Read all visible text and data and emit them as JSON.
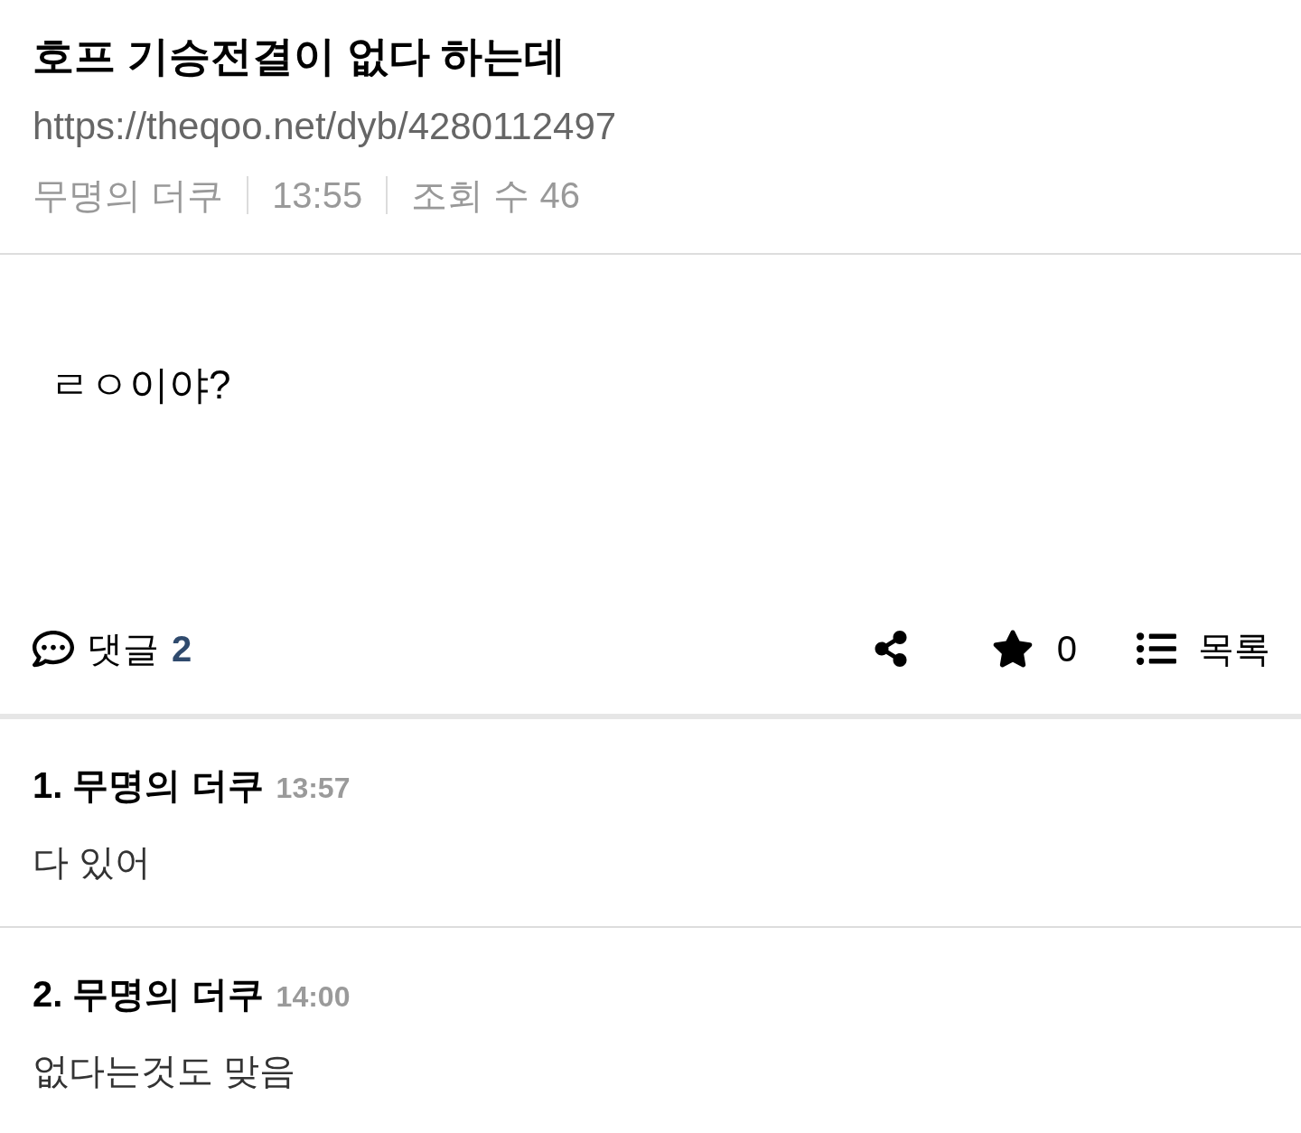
{
  "post": {
    "title": "호프 기승전결이 없다 하는데",
    "url": "https://theqoo.net/dyb/4280112497",
    "meta": [
      "무명의 더쿠",
      "13:55",
      "조회 수 46"
    ]
  },
  "body": "ㄹㅇ이야?",
  "actions": {
    "comments_label": "댓글",
    "comments_count": "2",
    "favorite_count": "0",
    "list_label": "목록"
  },
  "comments": [
    {
      "heading": "1. 무명의 더쿠",
      "time": "13:57",
      "text": "다 있어"
    },
    {
      "heading": "2. 무명의 더쿠",
      "time": "14:00",
      "text": "없다는것도 맞음"
    }
  ]
}
